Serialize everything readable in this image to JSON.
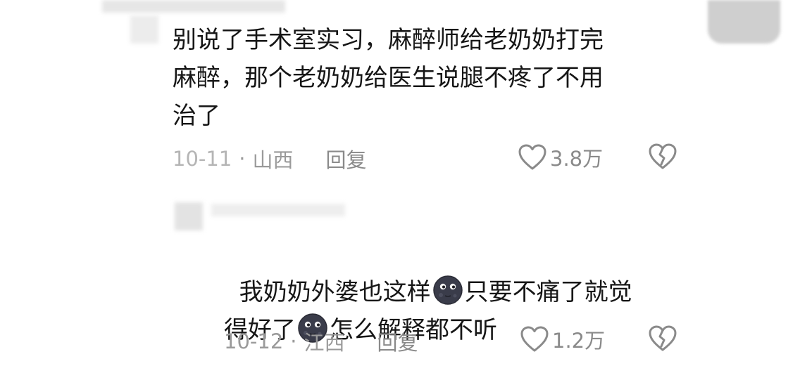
{
  "comments": [
    {
      "text": "别说了手术室实习，麻醉师给老奶奶打完\n麻醉，那个老奶奶给医生说腿不疼了不用\n治了",
      "date": "10-11",
      "separator": "·",
      "location": "山西",
      "reply_label": "回复",
      "likes": "3.8万"
    },
    {
      "text_parts": [
        "我奶奶外婆也这样",
        "只要不痛了就觉",
        "得好了",
        "怎么解释都不听"
      ],
      "emoji": "new-moon-face-emoji",
      "date": "10-12",
      "separator": "·",
      "location": "江西",
      "reply_label": "回复",
      "likes": "1.2万"
    }
  ],
  "icons": {
    "like": "heart-outline-icon",
    "dislike": "broken-heart-icon"
  },
  "colors": {
    "text": "#161616",
    "meta": "#9a9a9a",
    "icon": "#8a8a8a"
  }
}
